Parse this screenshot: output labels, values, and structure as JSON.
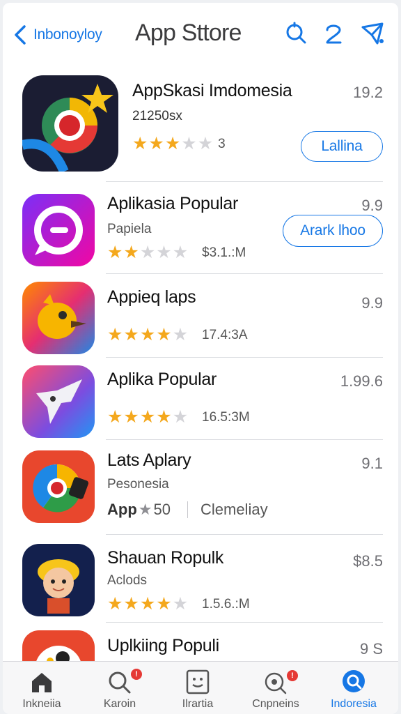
{
  "header": {
    "back_label": "Inbonoyloy",
    "title": "App Sttore"
  },
  "apps": [
    {
      "name": "AppSkasi Imdomesia",
      "subtitle": "21250sx",
      "rating_text": "3",
      "stars": 3,
      "rating": "19.2",
      "button": "Lallina"
    },
    {
      "name": "Aplikasia Popular",
      "subtitle": "Papiela",
      "size": "$3.1.:M",
      "stars": 2,
      "rating": "9.9",
      "button": "Arark lhoo"
    },
    {
      "name": "Appieq laps",
      "size": "17.4:3A",
      "stars": 4,
      "rating": "9.9"
    },
    {
      "name": "Aplika Popular",
      "size": "16.5:3M",
      "stars": 4,
      "rating": "1.99.6"
    },
    {
      "name": "Lats Aplary",
      "subtitle": "Pesonesia",
      "meta_prefix": "App",
      "meta_count": "50",
      "meta_category": "Clemeliay",
      "rating": "9.1"
    },
    {
      "name": "Shauan Ropulk",
      "subtitle": "Aclods",
      "size": "1.5.6.:M",
      "stars": 4,
      "rating": "$8.5"
    },
    {
      "name": "Uplkiing Populi",
      "rating": "9 S"
    }
  ],
  "tabs": [
    {
      "label": "Inkneiia",
      "icon": "home-icon"
    },
    {
      "label": "Karoin",
      "icon": "search-icon",
      "badge": "!"
    },
    {
      "label": "Ilrartia",
      "icon": "arcade-icon"
    },
    {
      "label": "Cnpneins",
      "icon": "updates-icon",
      "badge": "!"
    },
    {
      "label": "Indoresia",
      "icon": "today-icon",
      "active": true
    }
  ],
  "colors": {
    "accent": "#1677e5",
    "star": "#f4a81d",
    "star_off": "#d4d4d8",
    "badge": "#e53935"
  }
}
